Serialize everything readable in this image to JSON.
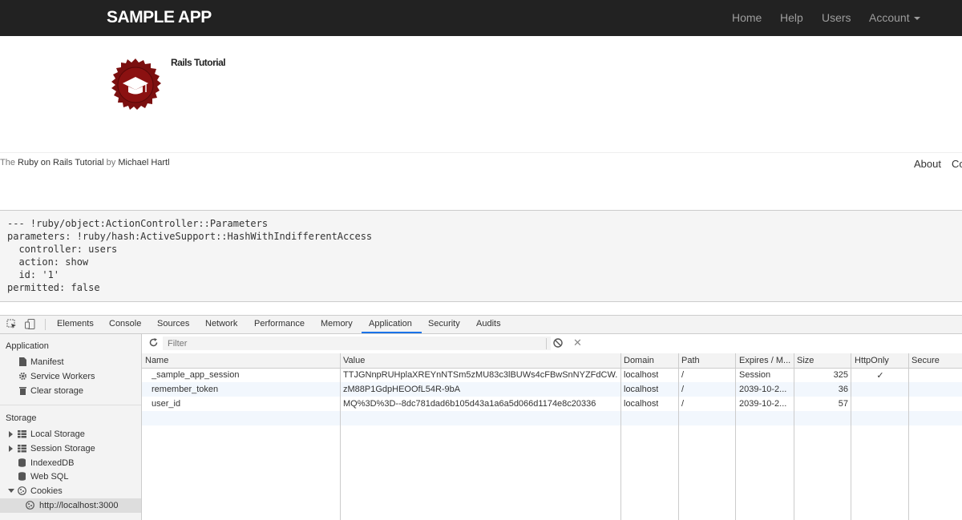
{
  "navbar": {
    "brand": "SAMPLE APP",
    "items": [
      "Home",
      "Help",
      "Users",
      "Account"
    ]
  },
  "content": {
    "logo_icon": "rails-seal-icon",
    "title": "Rails Tutorial"
  },
  "footer": {
    "prefix": "The ",
    "link1": "Ruby on Rails Tutorial",
    "mid": " by ",
    "link2": "Michael Hartl",
    "about": "About",
    "contact": "Co"
  },
  "debug": [
    "--- !ruby/object:ActionController::Parameters",
    "parameters: !ruby/hash:ActiveSupport::HashWithIndifferentAccess",
    "  controller: users",
    "  action: show",
    "  id: '1'",
    "permitted: false"
  ],
  "devtools": {
    "tabs": [
      "Elements",
      "Console",
      "Sources",
      "Network",
      "Performance",
      "Memory",
      "Application",
      "Security",
      "Audits"
    ],
    "active_tab": "Application",
    "sidebar": {
      "application_head": "Application",
      "application_items": [
        "Manifest",
        "Service Workers",
        "Clear storage"
      ],
      "storage_head": "Storage",
      "storage_items": [
        "Local Storage",
        "Session Storage",
        "IndexedDB",
        "Web SQL",
        "Cookies"
      ],
      "cookie_origin": "http://localhost:3000"
    },
    "filter_placeholder": "Filter",
    "columns": [
      "Name",
      "Value",
      "Domain",
      "Path",
      "Expires / M...",
      "Size",
      "HttpOnly",
      "Secure"
    ],
    "rows": [
      {
        "name": "_sample_app_session",
        "value": "TTJGNnpRUHplaXREYnNTSm5zMU83c3lBUWs4cFBwSnNYZFdCW...",
        "domain": "localhost",
        "path": "/",
        "expires": "Session",
        "size": "325",
        "httponly": "✓",
        "secure": ""
      },
      {
        "name": "remember_token",
        "value": "zM88P1GdpHEOOfL54R-9bA",
        "domain": "localhost",
        "path": "/",
        "expires": "2039-10-2...",
        "size": "36",
        "httponly": "",
        "secure": ""
      },
      {
        "name": "user_id",
        "value": "MQ%3D%3D--8dc781dad6b105d43a1a6a5d066d1174e8c20336",
        "domain": "localhost",
        "path": "/",
        "expires": "2039-10-2...",
        "size": "57",
        "httponly": "",
        "secure": ""
      }
    ]
  }
}
